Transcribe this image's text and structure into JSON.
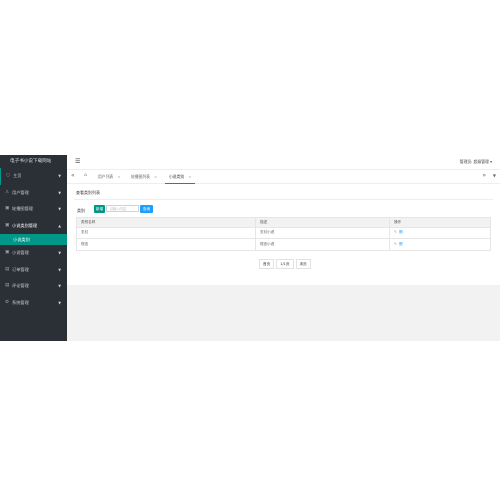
{
  "sidebar": {
    "brand": "电子书小说下载网站",
    "items": [
      {
        "label": "主页",
        "icon": "home-icon"
      },
      {
        "label": "用户管理",
        "icon": "user-icon"
      },
      {
        "label": "轮播图管理",
        "icon": "image-icon"
      },
      {
        "label": "小说类别管理",
        "icon": "category-icon"
      },
      {
        "label": "小说管理",
        "icon": "book-icon"
      },
      {
        "label": "订单管理",
        "icon": "order-icon"
      },
      {
        "label": "评论管理",
        "icon": "comment-icon"
      },
      {
        "label": "系统管理",
        "icon": "settings-icon"
      }
    ],
    "active_sub": "小说类别"
  },
  "topbar": {
    "admin_label": "管理员: 超级管理"
  },
  "tabs": [
    {
      "label": "用户列表"
    },
    {
      "label": "轮播图列表"
    },
    {
      "label": "小说类别"
    }
  ],
  "content": {
    "panel_title": "查看类别列表",
    "search_label": "类别",
    "add_button": "新增",
    "search_placeholder": "请输入内容",
    "search_button": "查询",
    "columns": [
      "类别名称",
      "描述",
      "操作"
    ],
    "rows": [
      {
        "name": "玄幻",
        "desc": "玄幻小说",
        "edit": "✎",
        "del": "删"
      },
      {
        "name": "现言",
        "desc": "现言小说",
        "edit": "✎",
        "del": "删"
      }
    ],
    "pager": {
      "prev": "首页",
      "page": "1/1页",
      "next": "末页"
    }
  },
  "colors": {
    "sidebar": "#2b2f36",
    "accent": "#009688",
    "blue": "#1e9fff"
  }
}
